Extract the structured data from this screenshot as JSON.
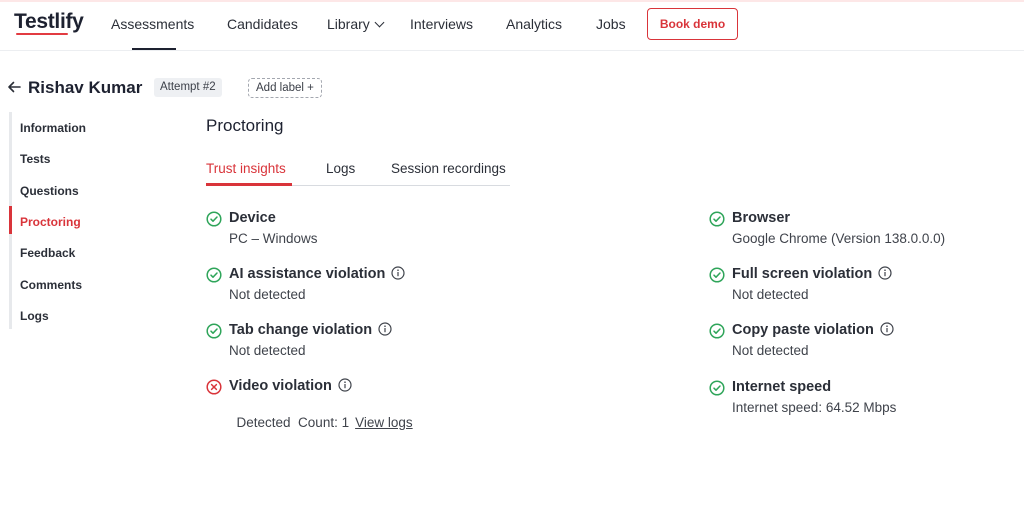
{
  "brand": {
    "name": "Testlify",
    "accent_color": "#d9343a"
  },
  "nav": {
    "items": [
      {
        "label": "Assessments",
        "active": true
      },
      {
        "label": "Candidates"
      },
      {
        "label": "Library",
        "has_dropdown": true
      },
      {
        "label": "Interviews"
      },
      {
        "label": "Analytics"
      },
      {
        "label": "Jobs"
      }
    ],
    "book_demo": "Book demo"
  },
  "candidate": {
    "name": "Rishav Kumar",
    "attempt": "Attempt #2",
    "add_label": "Add label +"
  },
  "sidebar": {
    "items": [
      {
        "label": "Information"
      },
      {
        "label": "Tests"
      },
      {
        "label": "Questions"
      },
      {
        "label": "Proctoring",
        "active": true
      },
      {
        "label": "Feedback"
      },
      {
        "label": "Comments"
      },
      {
        "label": "Logs"
      }
    ]
  },
  "main": {
    "title": "Proctoring",
    "tabs": [
      {
        "label": "Trust insights",
        "active": true
      },
      {
        "label": "Logs"
      },
      {
        "label": "Session recordings"
      }
    ]
  },
  "insights": {
    "left": [
      {
        "title": "Device",
        "value": "PC – Windows",
        "status": "ok",
        "info": false
      },
      {
        "title": "AI assistance violation",
        "value": "Not detected",
        "status": "ok",
        "info": true
      },
      {
        "title": "Tab change violation",
        "value": "Not detected",
        "status": "ok",
        "info": true
      },
      {
        "title": "Video violation",
        "value": "Detected  Count: 1",
        "link": "View logs",
        "status": "fail",
        "info": true
      }
    ],
    "right": [
      {
        "title": "Browser",
        "value": "Google Chrome (Version 138.0.0.0)",
        "status": "ok",
        "info": false
      },
      {
        "title": "Full screen violation",
        "value": "Not detected",
        "status": "ok",
        "info": true
      },
      {
        "title": "Copy paste violation",
        "value": "Not detected",
        "status": "ok",
        "info": true
      },
      {
        "title": "Internet speed",
        "value": "Internet speed: 64.52 Mbps",
        "status": "ok",
        "info": false
      }
    ]
  },
  "colors": {
    "ok": "#2fa55a",
    "fail": "#d9343a"
  }
}
